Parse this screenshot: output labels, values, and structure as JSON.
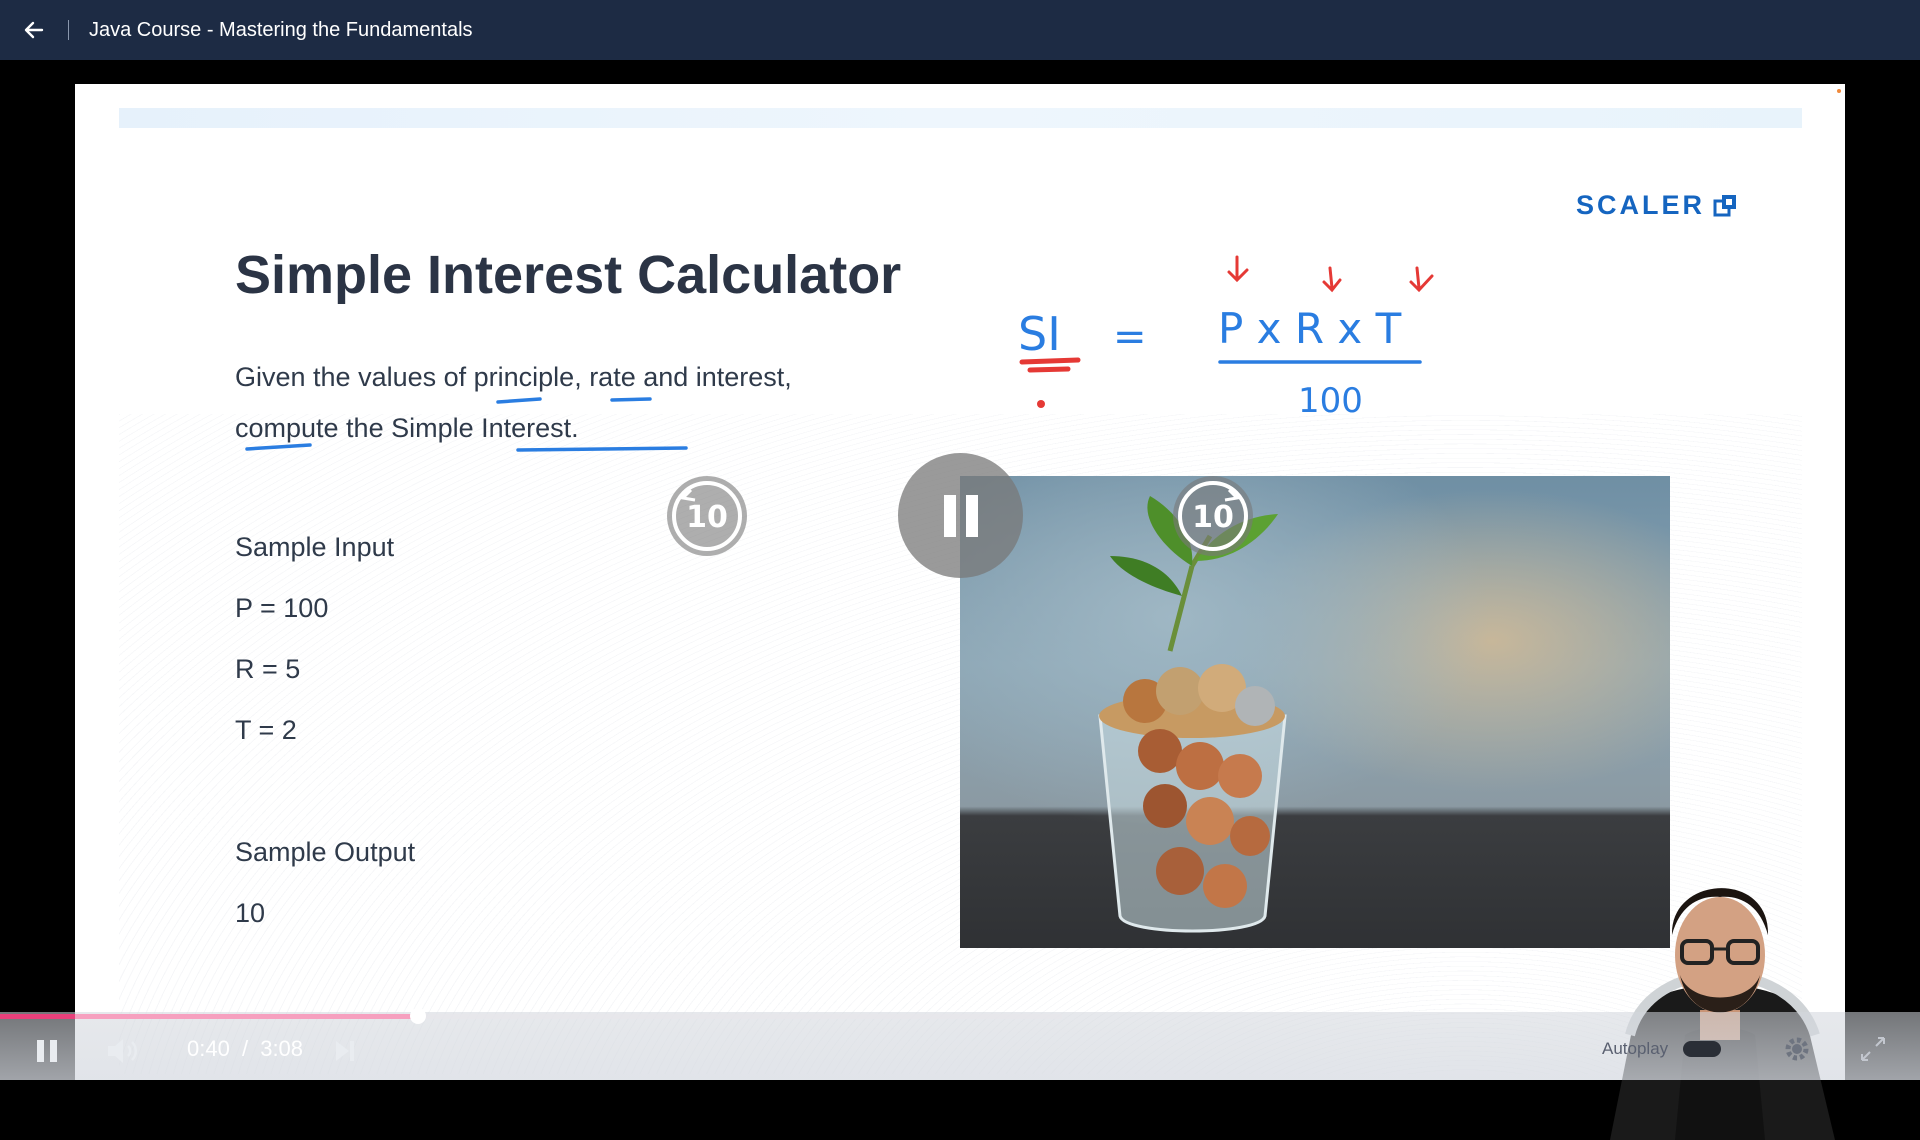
{
  "header": {
    "title": "Java Course - Mastering the Fundamentals"
  },
  "slide": {
    "brand": "SCALER",
    "title": "Simple Interest Calculator",
    "description": "Given the values of principle, rate and interest, compute the Simple Interest.",
    "sample_input_label": "Sample Input",
    "inputs": [
      "P = 100",
      "R = 5",
      "T = 2"
    ],
    "sample_output_label": "Sample Output",
    "output": "10",
    "annotation": {
      "lhs": "SI",
      "eq": "=",
      "numerator": "P x R x T",
      "denominator": "100"
    }
  },
  "overlay": {
    "rewind_seconds": "10",
    "forward_seconds": "10"
  },
  "player": {
    "current_time": "0:40",
    "separator": "/",
    "duration": "3:08",
    "progress_fraction": 0.213,
    "autoplay_label": "Autoplay",
    "autoplay_on": false
  },
  "colors": {
    "topbar": "#1d2b44",
    "accent_progress": "#e8407a",
    "brand": "#1565c0",
    "ink_blue": "#2a7de1",
    "ink_red": "#e53935"
  },
  "icons": [
    "back-arrow-icon",
    "pause-icon",
    "volume-icon",
    "next-icon",
    "rewind-10-icon",
    "forward-10-icon",
    "settings-gear-icon",
    "fullscreen-icon",
    "scaler-logo-icon"
  ]
}
